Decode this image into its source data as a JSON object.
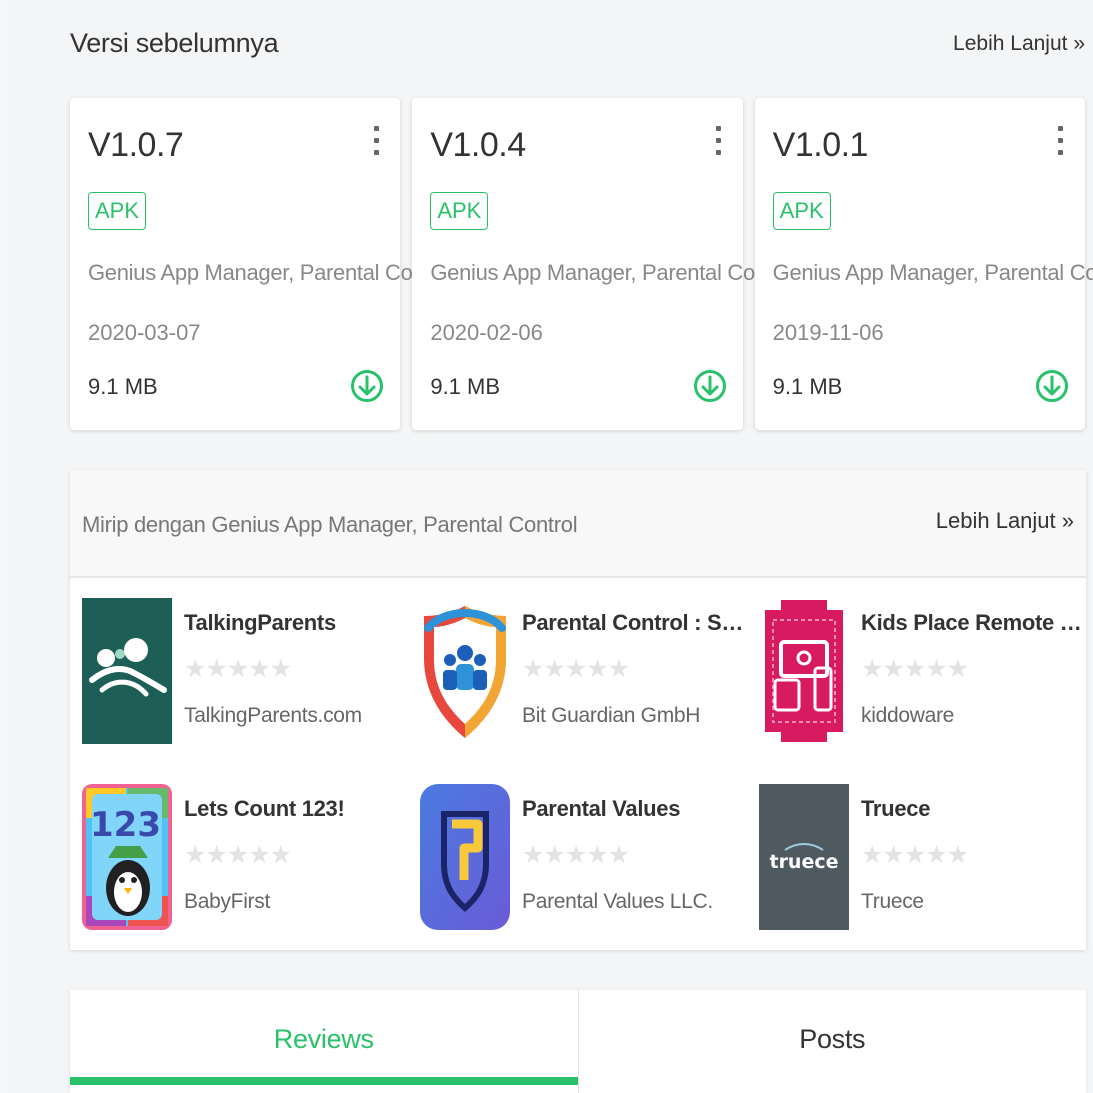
{
  "versions_section": {
    "title": "Versi sebelumnya",
    "more": "Lebih Lanjut »",
    "cards": [
      {
        "version": "V1.0.7",
        "badge": "APK",
        "name": "Genius App Manager, Parental Control",
        "date": "2020-03-07",
        "size": "9.1 MB"
      },
      {
        "version": "V1.0.4",
        "badge": "APK",
        "name": "Genius App Manager, Parental Control",
        "date": "2020-02-06",
        "size": "9.1 MB"
      },
      {
        "version": "V1.0.1",
        "badge": "APK",
        "name": "Genius App Manager, Parental Control",
        "date": "2019-11-06",
        "size": "9.1 MB"
      }
    ]
  },
  "similar_section": {
    "title": "Mirip dengan Genius App Manager, Parental Control",
    "more": "Lebih Lanjut »",
    "apps": [
      {
        "name": "TalkingParents",
        "stars": "★★★★★",
        "developer": "TalkingParents.com",
        "icon": "talkingparents-icon"
      },
      {
        "name": "Parental Control : Scre...",
        "stars": "★★★★★",
        "developer": "Bit Guardian GmbH",
        "icon": "family-shield-icon"
      },
      {
        "name": "Kids Place Remote Con...",
        "stars": "★★★★★",
        "developer": "kiddoware",
        "icon": "kids-place-icon"
      },
      {
        "name": "Lets Count 123!",
        "stars": "★★★★★",
        "developer": "BabyFirst",
        "icon": "lets-count-icon",
        "icon_text": "123"
      },
      {
        "name": "Parental Values",
        "stars": "★★★★★",
        "developer": "Parental Values LLC.",
        "icon": "parental-values-icon"
      },
      {
        "name": "Truece",
        "stars": "★★★★★",
        "developer": "Truece",
        "icon": "truece-icon",
        "icon_text": "truece"
      }
    ]
  },
  "tabs": [
    {
      "label": "Reviews",
      "active": true
    },
    {
      "label": "Posts",
      "active": false
    }
  ],
  "colors": {
    "accent": "#29c26a"
  }
}
